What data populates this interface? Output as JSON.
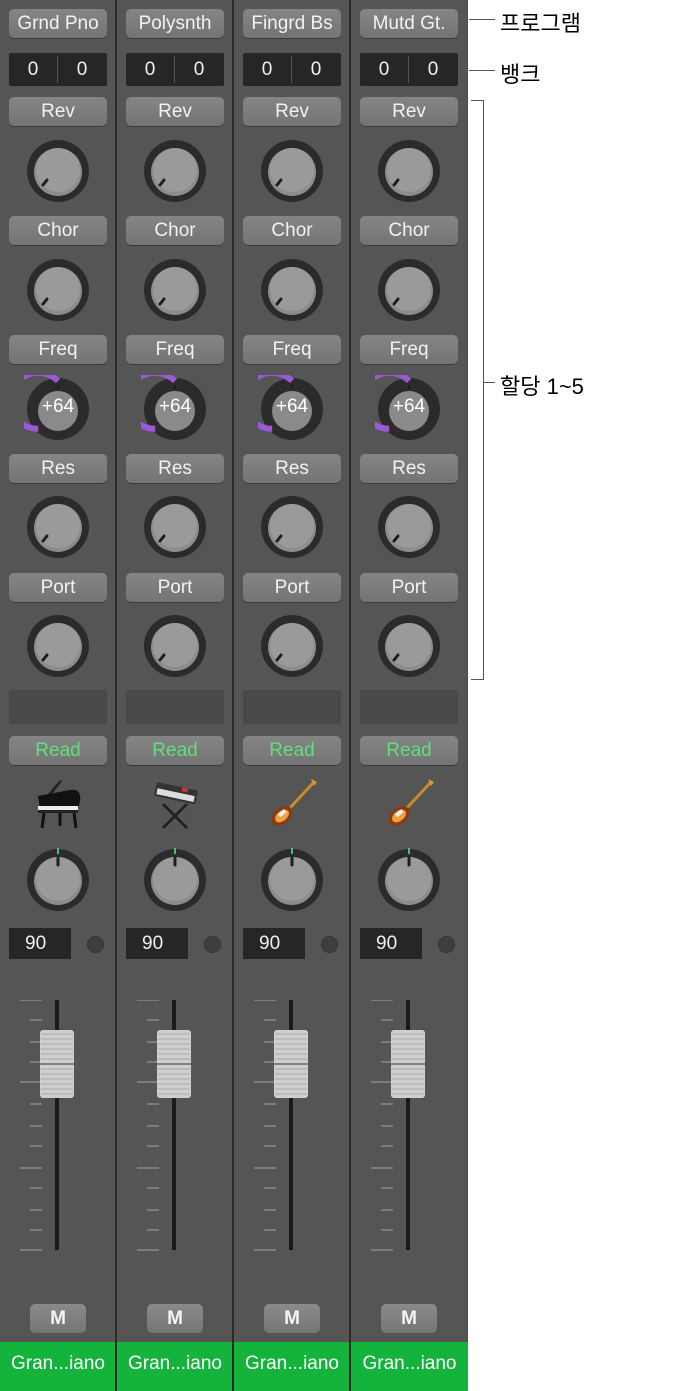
{
  "channels": [
    {
      "program": "Grnd Pno",
      "bank": [
        "0",
        "0"
      ],
      "assignments": [
        "Rev",
        "Chor",
        "Freq",
        "Res",
        "Port"
      ],
      "freq_value": "+64",
      "automation": "Read",
      "instrument_icon": "grand-piano-icon",
      "volume": "90",
      "mute": "M",
      "name": "Gran...iano"
    },
    {
      "program": "Polysnth",
      "bank": [
        "0",
        "0"
      ],
      "assignments": [
        "Rev",
        "Chor",
        "Freq",
        "Res",
        "Port"
      ],
      "freq_value": "+64",
      "automation": "Read",
      "instrument_icon": "synth-keyboard-icon",
      "volume": "90",
      "mute": "M",
      "name": "Gran...iano"
    },
    {
      "program": "Fingrd Bs",
      "bank": [
        "0",
        "0"
      ],
      "assignments": [
        "Rev",
        "Chor",
        "Freq",
        "Res",
        "Port"
      ],
      "freq_value": "+64",
      "automation": "Read",
      "instrument_icon": "electric-guitar-icon",
      "volume": "90",
      "mute": "M",
      "name": "Gran...iano"
    },
    {
      "program": "Mutd Gt.",
      "bank": [
        "0",
        "0"
      ],
      "assignments": [
        "Rev",
        "Chor",
        "Freq",
        "Res",
        "Port"
      ],
      "freq_value": "+64",
      "automation": "Read",
      "instrument_icon": "electric-guitar-icon",
      "volume": "90",
      "mute": "M",
      "name": "Gran...iano"
    }
  ],
  "callouts": {
    "program": "프로그램",
    "bank": "뱅크",
    "assignments": "할당 1~5"
  },
  "colors": {
    "read": "#5fe07a",
    "name_bar": "#14b43c",
    "freq_arc": "#9b59d6"
  }
}
